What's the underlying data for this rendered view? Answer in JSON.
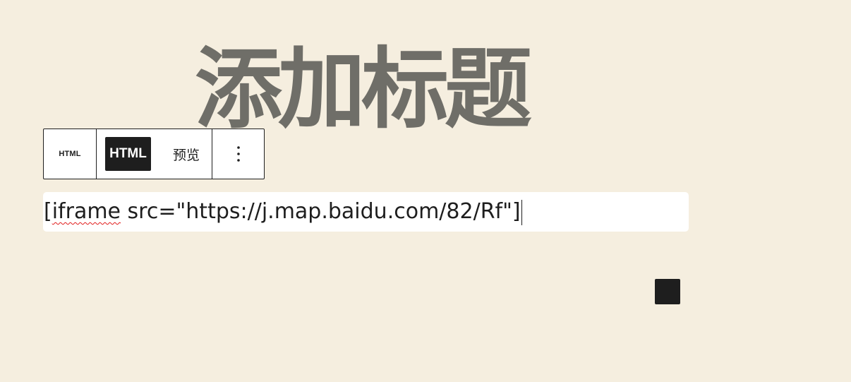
{
  "title": {
    "text": "添加标题"
  },
  "toolbar": {
    "block_type_label": "HTML",
    "mode_html_label": "HTML",
    "mode_preview_label": "预览",
    "more_icon": "vertical-ellipsis-icon"
  },
  "html_block": {
    "prefix": "[",
    "misspelled_word": "iframe",
    "rest": " src=\"https://j.map.baidu.com/82/Rf\"]"
  },
  "colors": {
    "background": "#f5eedf",
    "title": "#6f6e68",
    "dark": "#1e1e1e",
    "spellcheck": "#e11d1d"
  }
}
